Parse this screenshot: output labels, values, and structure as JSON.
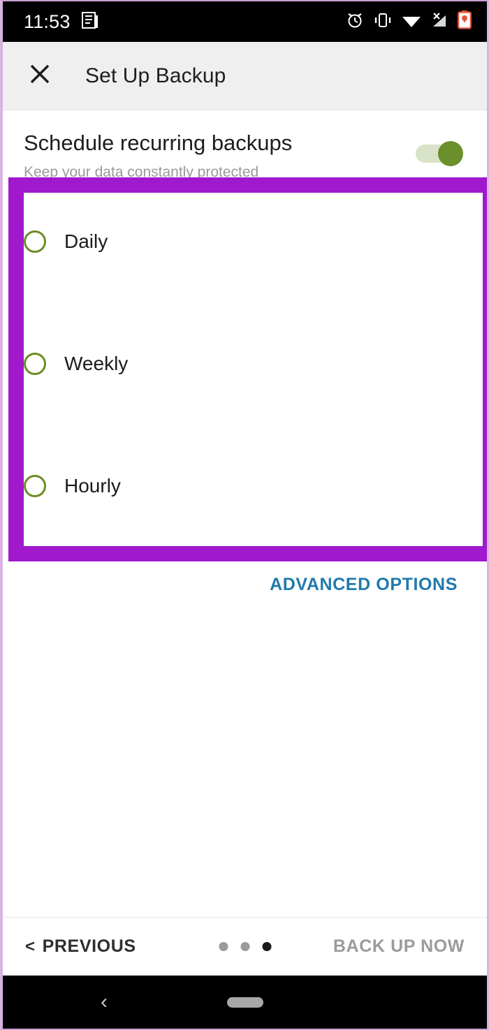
{
  "status_bar": {
    "time": "11:53",
    "icons_left": [
      "document-icon"
    ],
    "icons_right": [
      "alarm-icon",
      "vibrate-icon",
      "wifi-icon",
      "cellular-no-signal-icon",
      "battery-low-icon"
    ]
  },
  "app_bar": {
    "close_icon": "close-icon",
    "title": "Set Up Backup"
  },
  "schedule": {
    "title": "Schedule recurring backups",
    "subtitle": "Keep your data constantly protected",
    "toggle_on": true,
    "toggle_color": "#6b8f2b",
    "toggle_track_color": "#d9e3c8"
  },
  "frequency_options": [
    {
      "label": "Daily",
      "selected": false
    },
    {
      "label": "Weekly",
      "selected": false
    },
    {
      "label": "Hourly",
      "selected": false
    }
  ],
  "advanced": {
    "label": "ADVANCED OPTIONS",
    "color": "#2079ae"
  },
  "annotation": {
    "color": "#a019cd",
    "shape": "rectangle-highlight"
  },
  "bottom_bar": {
    "previous_label": "PREVIOUS",
    "previous_chevron": "<",
    "next_label": "BACK UP NOW",
    "dots_total": 3,
    "dots_active_index": 2
  },
  "nav_bar": {
    "back_glyph": "‹",
    "home_pill": "home-pill"
  }
}
